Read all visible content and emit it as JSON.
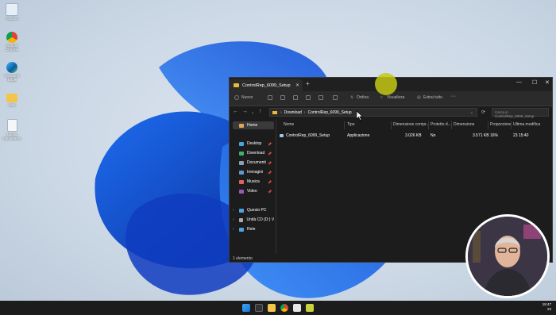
{
  "desktop": {
    "icons": [
      {
        "label": "Cestino",
        "icon": "recycle-bin-icon"
      },
      {
        "label": "Google Chrome",
        "icon": "chrome-icon"
      },
      {
        "label": "Microsoft Edge",
        "icon": "edge-icon"
      },
      {
        "label": "Vids",
        "icon": "folder-icon"
      },
      {
        "label": "Nuovo Documento",
        "icon": "document-icon"
      }
    ]
  },
  "explorer": {
    "tab_title": "ControlRep_6099_Setup",
    "toolbar": {
      "new_label": "Nuovo",
      "sort_label": "Ordina",
      "view_label": "Visualizza",
      "extract_label": "Estrai tutto",
      "more_label": "···"
    },
    "address": {
      "crumbs": [
        "Download",
        "ControlRep_6099_Setup"
      ],
      "search_placeholder": "Cerca in ControlRep_6099_Setup"
    },
    "nav": {
      "home": "Home",
      "quick": [
        "Desktop",
        "Download",
        "Documenti",
        "Immagini",
        "Musica",
        "Video"
      ],
      "this_pc": "Questo PC",
      "drive": "Unità CD (D:) Virtual",
      "network": "Rete"
    },
    "columns": [
      "Nome",
      "Tipo",
      "Dimensione compr...",
      "Protetto d...",
      "Dimensione",
      "Proporzione",
      "Ultima modifica"
    ],
    "rows": [
      {
        "name": "ControlRep_6099_Setup",
        "type": "Applicazione",
        "compressed": "3.026 KB",
        "protected": "No",
        "size": "3.571 KB",
        "ratio": "16%",
        "modified": "23 15:40"
      }
    ],
    "status": "1 elemento"
  },
  "taskbar": {
    "time": "18:47",
    "date": "23"
  },
  "colors": {
    "accent": "#0078d4",
    "folder": "#e8b93a",
    "dark_bg": "#1c1c1c"
  }
}
